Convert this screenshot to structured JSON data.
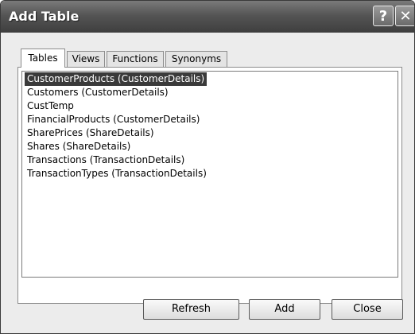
{
  "window": {
    "title": "Add Table",
    "help_glyph": "?",
    "close_glyph": "✕"
  },
  "tabs": [
    {
      "label": "Tables",
      "active": true
    },
    {
      "label": "Views",
      "active": false
    },
    {
      "label": "Functions",
      "active": false
    },
    {
      "label": "Synonyms",
      "active": false
    }
  ],
  "list": {
    "items": [
      {
        "label": "CustomerProducts (CustomerDetails)",
        "selected": true
      },
      {
        "label": "Customers (CustomerDetails)",
        "selected": false
      },
      {
        "label": "CustTemp",
        "selected": false
      },
      {
        "label": "FinancialProducts (CustomerDetails)",
        "selected": false
      },
      {
        "label": "SharePrices (ShareDetails)",
        "selected": false
      },
      {
        "label": "Shares (ShareDetails)",
        "selected": false
      },
      {
        "label": "Transactions (TransactionDetails)",
        "selected": false
      },
      {
        "label": "TransactionTypes (TransactionDetails)",
        "selected": false
      }
    ]
  },
  "buttons": {
    "refresh": "Refresh",
    "add": "Add",
    "close": "Close"
  },
  "colors": {
    "selection": "#3a3a3a",
    "titlebar": "#555555"
  },
  "icons": {
    "help": "help-icon",
    "close": "close-icon"
  }
}
